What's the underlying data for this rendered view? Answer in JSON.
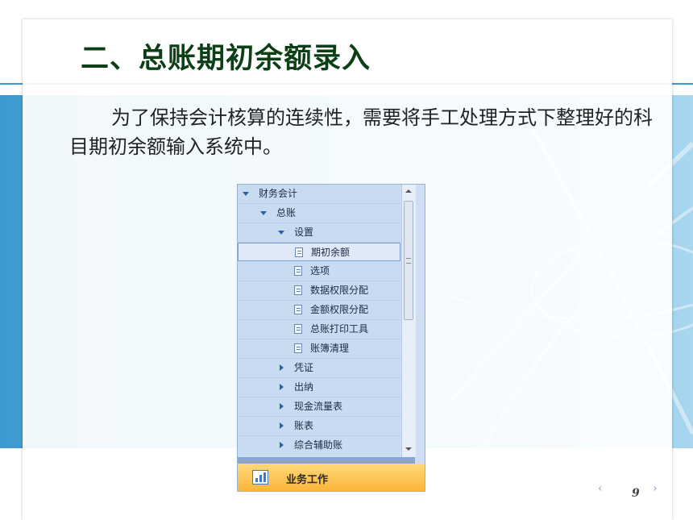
{
  "slide": {
    "title": "二、总账期初余额录入",
    "body": "为了保持会计核算的连续性，需要将手工处理方式下整理好的科目期初余额输入系统中。",
    "page_number": "9",
    "prev_label": "‹",
    "next_label": "›"
  },
  "nav": {
    "rows": [
      {
        "label": "财务会计",
        "icon": "expanded-arrow-icon"
      },
      {
        "label": "总账",
        "icon": "expanded-arrow-icon"
      },
      {
        "label": "设置",
        "icon": "expanded-arrow-icon"
      },
      {
        "label": "期初余额",
        "icon": "document-icon"
      },
      {
        "label": "选项",
        "icon": "document-icon"
      },
      {
        "label": "数据权限分配",
        "icon": "document-icon"
      },
      {
        "label": "金额权限分配",
        "icon": "document-icon"
      },
      {
        "label": "总账打印工具",
        "icon": "document-icon"
      },
      {
        "label": "账簿清理",
        "icon": "document-icon"
      },
      {
        "label": "凭证",
        "icon": "collapsed-arrow-icon"
      },
      {
        "label": "出纳",
        "icon": "collapsed-arrow-icon"
      },
      {
        "label": "现金流量表",
        "icon": "collapsed-arrow-icon"
      },
      {
        "label": "账表",
        "icon": "collapsed-arrow-icon"
      },
      {
        "label": "综合辅助账",
        "icon": "collapsed-arrow-icon"
      }
    ],
    "selected_item": "期初余额",
    "bottom_button": "业务工作"
  },
  "colors": {
    "title": "#0d3f17",
    "band": "#3d9ad1",
    "nav_bg": "#c9dbf1",
    "button": "#fdb53a"
  }
}
